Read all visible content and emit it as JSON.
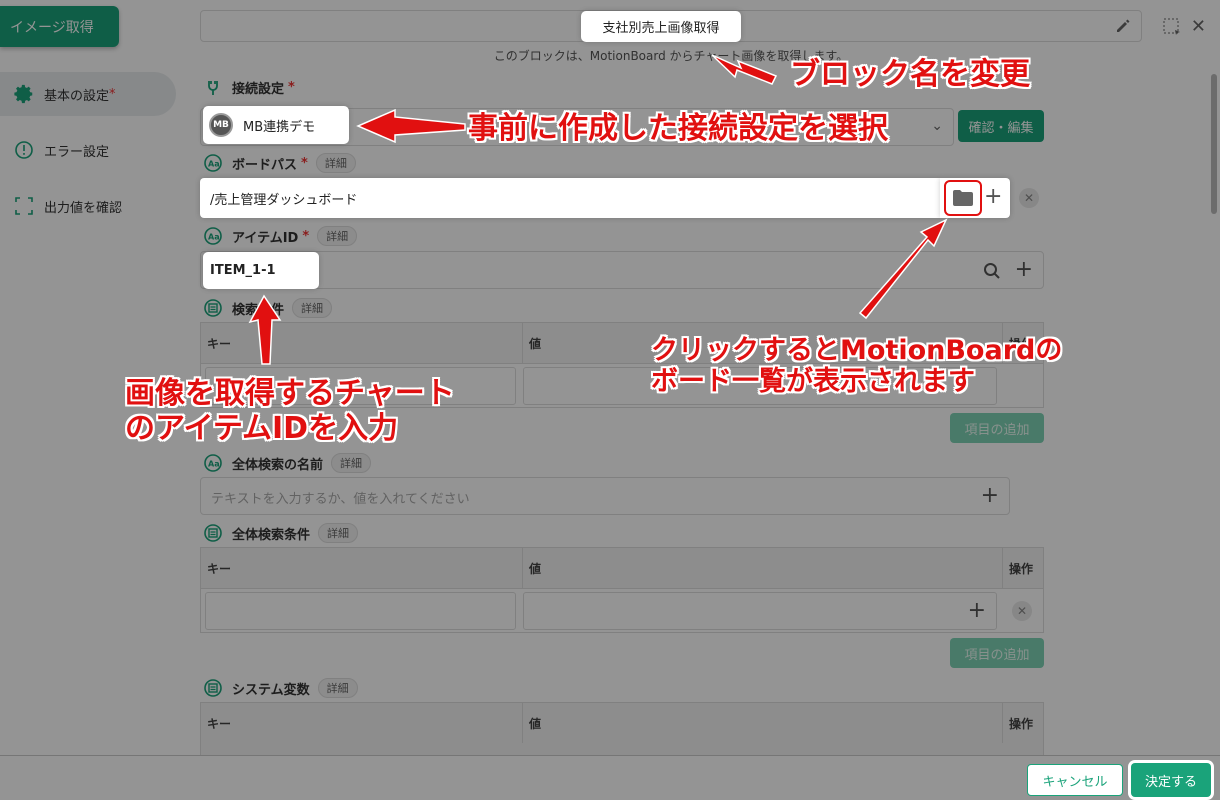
{
  "top_button": {
    "label": "イメージ取得"
  },
  "block": {
    "title": "支社別売上画像取得",
    "description": "このブロックは、MotionBoard からチャート画像を取得します。"
  },
  "sidebar": {
    "items": [
      {
        "label": "基本の設定",
        "required_mark": "*",
        "icon": "gear-icon"
      },
      {
        "label": "エラー設定",
        "icon": "alert-circle-icon"
      },
      {
        "label": "出力値を確認",
        "icon": "dashed-frame-icon"
      }
    ]
  },
  "connection": {
    "label": "接続設定",
    "required_mark": "*",
    "value": "MB連携デモ",
    "avatar_text": "MB",
    "confirm_edit_button": "確認・編集"
  },
  "board_path": {
    "label": "ボードパス",
    "required_mark": "*",
    "detail_badge": "詳細",
    "value": "/売上管理ダッシュボード"
  },
  "item_id": {
    "label": "アイテムID",
    "required_mark": "*",
    "detail_badge": "詳細",
    "value": "ITEM_1-1"
  },
  "search_conditions": {
    "label": "検索条件",
    "detail_badge": "詳細",
    "columns": [
      "キー",
      "値",
      "操作"
    ],
    "add_button": "項目の追加"
  },
  "global_search_name": {
    "label": "全体検索の名前",
    "detail_badge": "詳細",
    "placeholder": "テキストを入力するか、値を入れてください"
  },
  "global_search_conditions": {
    "label": "全体検索条件",
    "detail_badge": "詳細",
    "columns": [
      "キー",
      "値",
      "操作"
    ],
    "add_button": "項目の追加"
  },
  "system_variables": {
    "label": "システム変数",
    "detail_badge": "詳細",
    "columns": [
      "キー",
      "値",
      "操作"
    ]
  },
  "footer": {
    "cancel_button": "キャンセル",
    "decide_button": "決定する"
  },
  "annotations": {
    "rename_block": "ブロック名を変更",
    "select_connection": "事前に作成した接続設定を選択",
    "item_id_line1": "画像を取得するチャート",
    "item_id_line2": "のアイテムIDを入力",
    "board_list_line1": "クリックするとMotionBoardの",
    "board_list_line2": "ボード一覧が表示されます"
  },
  "colors": {
    "accent_green": "#1aa37a",
    "annotation_red": "#e11010"
  }
}
